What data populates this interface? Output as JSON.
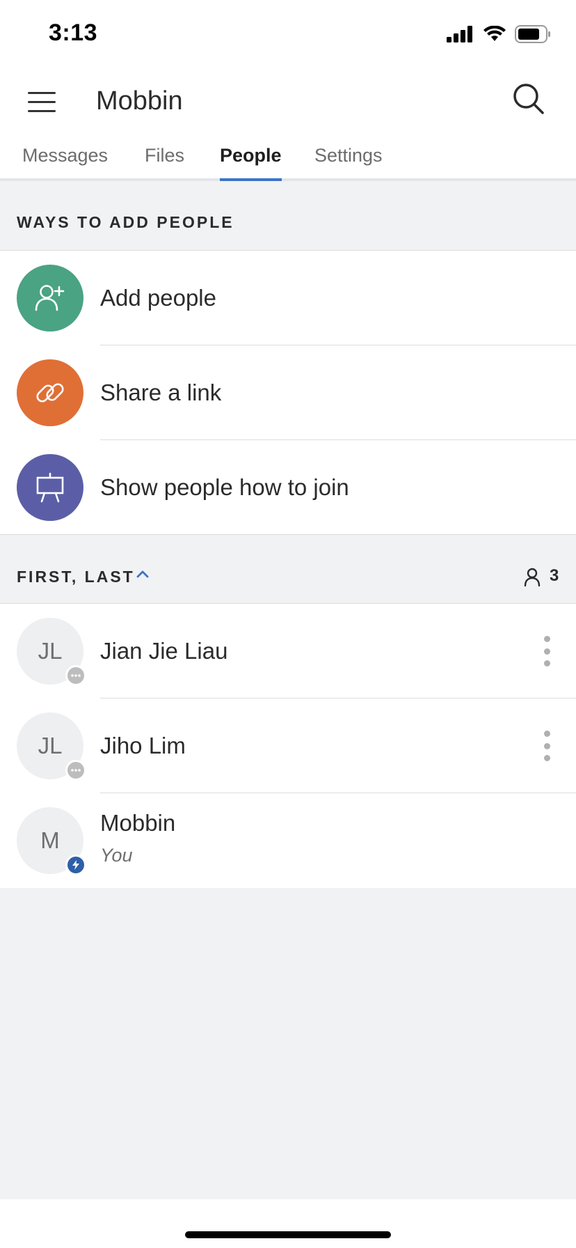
{
  "status_bar": {
    "time": "3:13"
  },
  "app_bar": {
    "title": "Mobbin",
    "menu_icon": "hamburger-icon",
    "search_icon": "search-icon"
  },
  "tabs": [
    {
      "label": "Messages",
      "active": false
    },
    {
      "label": "Files",
      "active": false
    },
    {
      "label": "People",
      "active": true
    },
    {
      "label": "Settings",
      "active": false
    }
  ],
  "ways_section": {
    "header": "WAYS TO ADD PEOPLE",
    "items": [
      {
        "label": "Add people",
        "icon": "add-person-icon",
        "color": "#4aa383"
      },
      {
        "label": "Share a link",
        "icon": "link-icon",
        "color": "#e06f36"
      },
      {
        "label": "Show people how to join",
        "icon": "presentation-icon",
        "color": "#5b5ea6"
      }
    ]
  },
  "people_section": {
    "sort_label": "FIRST, LAST",
    "sort_icon": "chevron-up-icon",
    "member_icon": "person-icon",
    "member_count": "3",
    "members": [
      {
        "initials": "JL",
        "name": "Jian Jie Liau",
        "presence": "more-icon",
        "has_menu": true
      },
      {
        "initials": "JL",
        "name": "Jiho Lim",
        "presence": "more-icon",
        "has_menu": true
      },
      {
        "initials": "M",
        "name": "Mobbin",
        "subtitle": "You",
        "presence": "lightning-icon",
        "has_menu": false
      }
    ]
  },
  "colors": {
    "accent": "#3b74c7",
    "green": "#4aa383",
    "orange": "#e06f36",
    "purple": "#5b5ea6",
    "self_badge": "#2f5fa8"
  }
}
